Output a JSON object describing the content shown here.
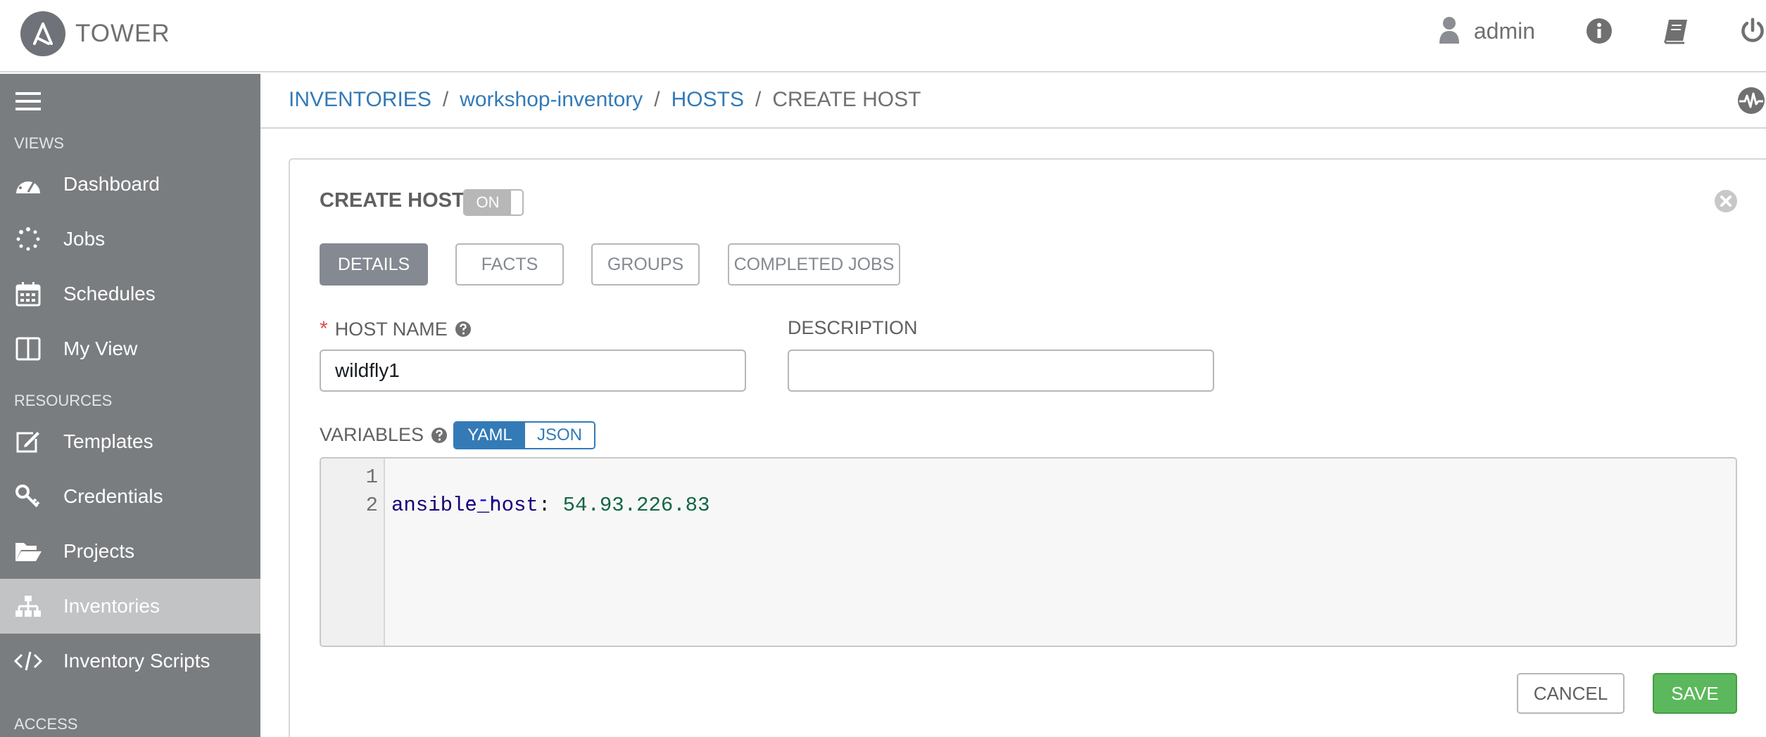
{
  "app": {
    "brand_name": "TOWER"
  },
  "header": {
    "user_name": "admin"
  },
  "sidebar": {
    "sections": [
      "VIEWS",
      "RESOURCES",
      "ACCESS"
    ],
    "items": [
      {
        "label": "Dashboard",
        "icon": "dashboard-icon"
      },
      {
        "label": "Jobs",
        "icon": "jobs-spinner-icon"
      },
      {
        "label": "Schedules",
        "icon": "calendar-icon"
      },
      {
        "label": "My View",
        "icon": "columns-icon"
      },
      {
        "label": "Templates",
        "icon": "edit-icon"
      },
      {
        "label": "Credentials",
        "icon": "key-icon"
      },
      {
        "label": "Projects",
        "icon": "folder-icon"
      },
      {
        "label": "Inventories",
        "icon": "sitemap-icon",
        "active": true
      },
      {
        "label": "Inventory Scripts",
        "icon": "code-icon"
      }
    ]
  },
  "breadcrumb": [
    "INVENTORIES",
    "workshop-inventory",
    "HOSTS",
    "CREATE HOST"
  ],
  "form": {
    "title": "CREATE HOST",
    "toggle_label": "ON",
    "tabs": [
      "DETAILS",
      "FACTS",
      "GROUPS",
      "COMPLETED JOBS"
    ],
    "host_name_label": "HOST NAME",
    "host_name_value": "wildfly1",
    "description_label": "DESCRIPTION",
    "description_value": "",
    "variables_label": "VARIABLES",
    "format_options": [
      "YAML",
      "JSON"
    ],
    "selected_format": "YAML",
    "editor": {
      "line_numbers": [
        "1",
        "2"
      ],
      "line1": "---",
      "line2_key": "ansible_host",
      "line2_sep": ":",
      "line2_value": "54.93.226.83"
    },
    "cancel_label": "CANCEL",
    "save_label": "SAVE"
  },
  "colors": {
    "sidebar_bg": "#7a7d80",
    "active_nav_bg": "#c2c3c4",
    "link": "#337ab7",
    "save": "#5cb85c",
    "required": "#d9534f"
  }
}
